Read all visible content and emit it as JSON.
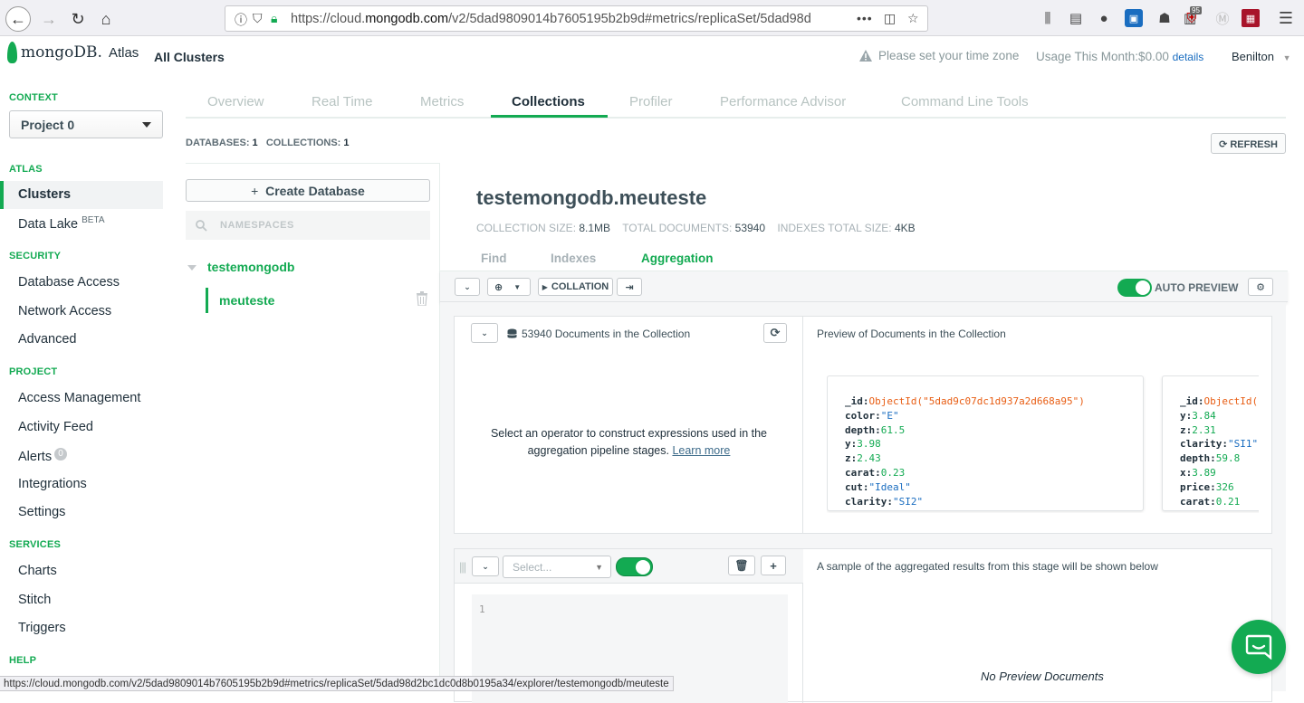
{
  "browser": {
    "url_prefix": "https://cloud.",
    "url_domain": "mongodb.com",
    "url_rest": "/v2/5dad9809014b7605195b2b9d#metrics/replicaSet/5dad98d",
    "ext_badge": "95"
  },
  "header": {
    "logo_text": "mongoDB.",
    "logo_atlas": "Atlas",
    "all_clusters": "All Clusters",
    "timezone_warning": "Please set your time zone",
    "usage_label": "Usage This Month:$0.00",
    "usage_details": "details",
    "user": "Benilton"
  },
  "sidebar": {
    "context_label": "CONTEXT",
    "project": "Project 0",
    "atlas_label": "ATLAS",
    "clusters": "Clusters",
    "data_lake": "Data Lake",
    "data_lake_tag": "BETA",
    "security_label": "SECURITY",
    "database_access": "Database Access",
    "network_access": "Network Access",
    "advanced": "Advanced",
    "project_label": "PROJECT",
    "access_management": "Access Management",
    "activity_feed": "Activity Feed",
    "alerts": "Alerts",
    "alerts_count": "0",
    "integrations": "Integrations",
    "settings": "Settings",
    "services_label": "SERVICES",
    "charts": "Charts",
    "stitch": "Stitch",
    "triggers": "Triggers",
    "help_label": "HELP"
  },
  "tabs": [
    "Overview",
    "Real Time",
    "Metrics",
    "Collections",
    "Profiler",
    "Performance Advisor",
    "Command Line Tools"
  ],
  "counts": {
    "databases_label": "DATABASES:",
    "databases": "1",
    "collections_label": "COLLECTIONS:",
    "collections": "1",
    "refresh": "REFRESH"
  },
  "namespaces": {
    "create_db": "Create Database",
    "search_placeholder": "NAMESPACES",
    "database": "testemongodb",
    "collection": "meuteste"
  },
  "collection": {
    "title": "testemongodb.meuteste",
    "size_label": "COLLECTION SIZE:",
    "size": "8.1MB",
    "docs_label": "TOTAL DOCUMENTS:",
    "docs": "53940",
    "index_label": "INDEXES TOTAL SIZE:",
    "index": "4KB",
    "subtabs": [
      "Find",
      "Indexes",
      "Aggregation"
    ]
  },
  "toolbar": {
    "collation": "COLLATION",
    "auto_preview": "AUTO PREVIEW"
  },
  "pipeline": {
    "source_count": "53940 Documents in the Collection",
    "source_help": "Select an operator to construct expressions used in the aggregation pipeline stages.",
    "learn_more": "Learn more",
    "preview_title": "Preview of Documents in the Collection",
    "stage_select_placeholder": "Select...",
    "stage_preview_msg": "A sample of the aggregated results from this stage will be shown below",
    "no_preview": "No Preview Documents",
    "editor_line": "1"
  },
  "documents": [
    {
      "_id": "ObjectId(\"5dad9c07dc1d937a2d668a95\")",
      "color": "\"E\"",
      "depth": "61.5",
      "y": "3.98",
      "z": "2.43",
      "carat": "0.23",
      "cut": "\"Ideal\"",
      "clarity": "\"SI2\""
    },
    {
      "_id": "ObjectId(",
      "y": "3.84",
      "z": "2.31",
      "clarity": "\"SI1\"",
      "depth": "59.8",
      "x": "3.89",
      "price": "326",
      "carat": "0.21"
    }
  ],
  "status_url": "https://cloud.mongodb.com/v2/5dad9809014b7605195b2b9d#metrics/replicaSet/5dad98d2bc1dc0d8b0195a34/explorer/testemongodb/meuteste",
  "colors": {
    "accent": "#13aa52",
    "link": "#1a6dc0",
    "object_id": "#e85d13"
  }
}
